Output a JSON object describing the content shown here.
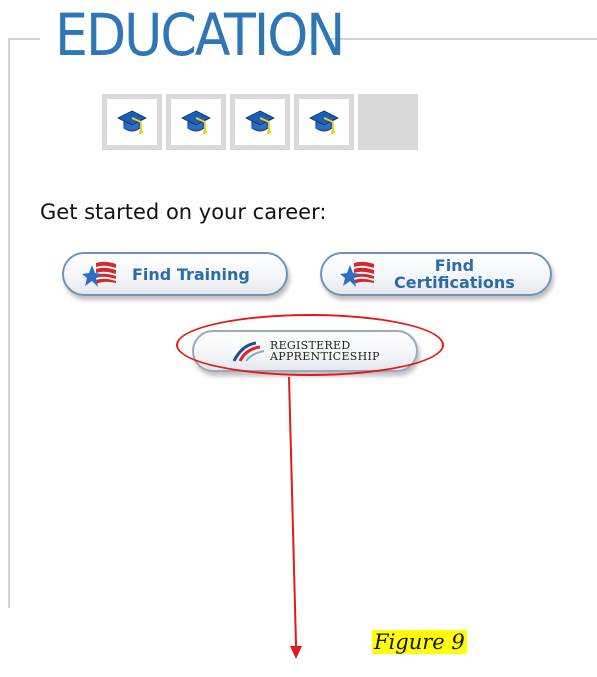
{
  "section": {
    "title": "EDUCATION"
  },
  "rating": {
    "filled_count": 4,
    "total": 5,
    "icon": "graduation-cap-icon"
  },
  "prompt": "Get started on your career:",
  "buttons": {
    "find_training": "Find Training",
    "find_certifications_line1": "Find",
    "find_certifications_line2": "Certifications",
    "apprenticeship_line1": "REGISTERED",
    "apprenticeship_line2": "APPRENTICESHIP"
  },
  "annotation": {
    "figure_label": "Figure 9",
    "highlight_color": "#e11a1a"
  },
  "colors": {
    "title": "#2e77b6",
    "button_text": "#2d6aa8",
    "figure_highlight": "#ffff00"
  }
}
